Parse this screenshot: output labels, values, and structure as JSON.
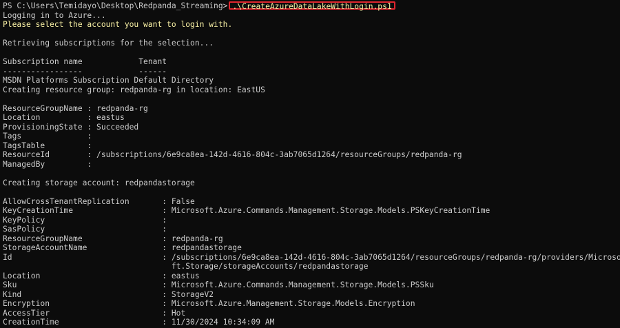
{
  "terminal": {
    "prompt": "PS C:\\Users\\Temidayo\\Desktop\\Redpanda_Streaming>",
    "command": ".\\CreateAzureDataLakeWithLogin.ps1",
    "lines": [
      {
        "text": "Logging in to Azure...",
        "style": "normal"
      },
      {
        "text": "Please select the account you want to login with.",
        "style": "warn"
      },
      {
        "text": "",
        "style": "normal"
      },
      {
        "text": "Retrieving subscriptions for the selection...",
        "style": "normal"
      },
      {
        "text": "",
        "style": "normal"
      },
      {
        "text": "Subscription name            Tenant",
        "style": "normal"
      },
      {
        "text": "-----------------            ------",
        "style": "normal"
      },
      {
        "text": "MSDN Platforms Subscription Default Directory",
        "style": "normal"
      },
      {
        "text": "Creating resource group: redpanda-rg in location: EastUS",
        "style": "normal"
      },
      {
        "text": "",
        "style": "normal"
      },
      {
        "text": "ResourceGroupName : redpanda-rg",
        "style": "normal"
      },
      {
        "text": "Location          : eastus",
        "style": "normal"
      },
      {
        "text": "ProvisioningState : Succeeded",
        "style": "normal"
      },
      {
        "text": "Tags              :",
        "style": "normal"
      },
      {
        "text": "TagsTable         :",
        "style": "normal"
      },
      {
        "text": "ResourceId        : /subscriptions/6e9ca8ea-142d-4616-804c-3ab7065d1264/resourceGroups/redpanda-rg",
        "style": "normal"
      },
      {
        "text": "ManagedBy         :",
        "style": "normal"
      },
      {
        "text": "",
        "style": "normal"
      },
      {
        "text": "Creating storage account: redpandastorage",
        "style": "normal"
      },
      {
        "text": "",
        "style": "normal"
      },
      {
        "text": "AllowCrossTenantReplication       : False",
        "style": "normal"
      },
      {
        "text": "KeyCreationTime                   : Microsoft.Azure.Commands.Management.Storage.Models.PSKeyCreationTime",
        "style": "normal"
      },
      {
        "text": "KeyPolicy                         :",
        "style": "normal"
      },
      {
        "text": "SasPolicy                         :",
        "style": "normal"
      },
      {
        "text": "ResourceGroupName                 : redpanda-rg",
        "style": "normal"
      },
      {
        "text": "StorageAccountName                : redpandastorage",
        "style": "normal"
      },
      {
        "text": "Id                                : /subscriptions/6e9ca8ea-142d-4616-804c-3ab7065d1264/resourceGroups/redpanda-rg/providers/Microso",
        "style": "normal"
      },
      {
        "text": "                                    ft.Storage/storageAccounts/redpandastorage",
        "style": "normal"
      },
      {
        "text": "Location                          : eastus",
        "style": "normal"
      },
      {
        "text": "Sku                               : Microsoft.Azure.Commands.Management.Storage.Models.PSSku",
        "style": "normal"
      },
      {
        "text": "Kind                              : StorageV2",
        "style": "normal"
      },
      {
        "text": "Encryption                        : Microsoft.Azure.Management.Storage.Models.Encryption",
        "style": "normal"
      },
      {
        "text": "AccessTier                        : Hot",
        "style": "normal"
      },
      {
        "text": "CreationTime                      : 11/30/2024 10:34:09 AM",
        "style": "normal"
      }
    ]
  },
  "colors": {
    "background": "#0c0c0c",
    "text": "#cccccc",
    "warning": "#f9f1a5",
    "highlight_box": "#e0262f"
  }
}
